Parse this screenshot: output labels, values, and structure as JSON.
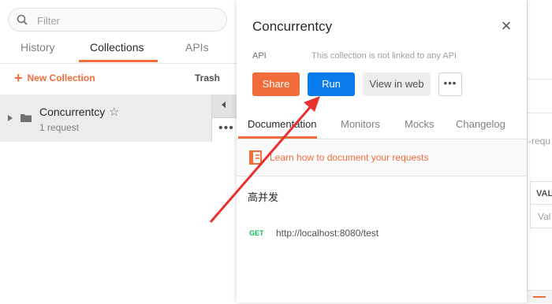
{
  "search": {
    "placeholder": "Filter"
  },
  "sidebar": {
    "tabs": [
      {
        "label": "History"
      },
      {
        "label": "Collections"
      },
      {
        "label": "APIs"
      }
    ],
    "new_collection": "New Collection",
    "trash": "Trash",
    "collection": {
      "name": "Concurrentcy",
      "meta": "1 request"
    }
  },
  "panel": {
    "title": "Concurrentcy",
    "close_glyph": "×",
    "api_label": "API",
    "api_note": "This collection is not linked to any API",
    "buttons": {
      "share": "Share",
      "run": "Run",
      "view_web": "View in web",
      "more": "•••"
    },
    "tabs": [
      {
        "label": "Documentation"
      },
      {
        "label": "Monitors"
      },
      {
        "label": "Mocks"
      },
      {
        "label": "Changelog"
      }
    ],
    "learn_link": "Learn how to document your requests",
    "description": "高并发",
    "request": {
      "method": "GET",
      "url": "http://localhost:8080/test"
    }
  },
  "background": {
    "partial_text": "-requ",
    "column_header": "VAL",
    "cell_placeholder": "Val"
  },
  "colors": {
    "accent_orange": "#f26b3a",
    "run_blue": "#097bed",
    "get_green": "#0cbb52",
    "annotation_red": "#e8312f"
  },
  "icons": [
    "search-icon",
    "plus-icon",
    "caret-right-icon",
    "folder-icon",
    "star-icon",
    "collapse-arrow-icon",
    "more-icon",
    "close-icon",
    "book-icon",
    "wrap-icon",
    "annotation-arrow"
  ]
}
